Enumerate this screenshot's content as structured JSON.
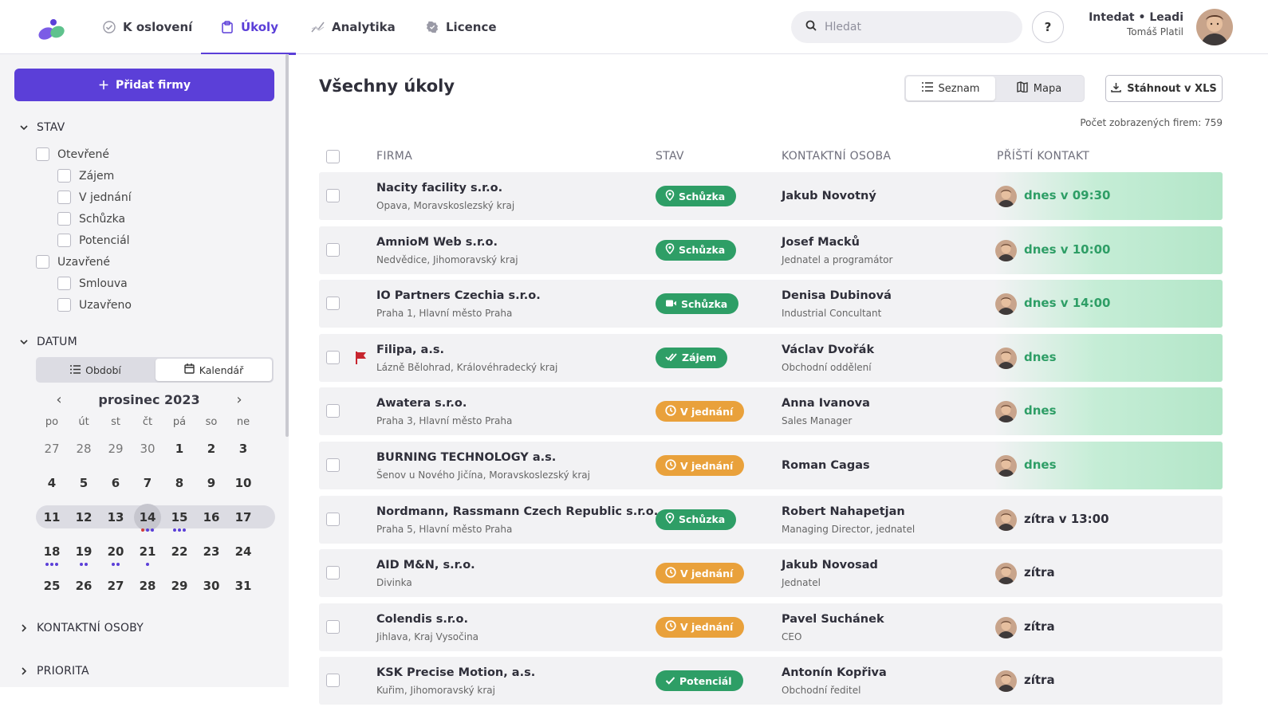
{
  "nav": {
    "items": [
      {
        "label": "K oslovení",
        "icon": "check-circle-icon"
      },
      {
        "label": "Úkoly",
        "icon": "clipboard-icon",
        "active": true
      },
      {
        "label": "Analytika",
        "icon": "chart-line-icon"
      },
      {
        "label": "Licence",
        "icon": "badge-icon"
      }
    ],
    "search_placeholder": "Hledat",
    "help_label": "?",
    "user_company": "Intedat • Leadi",
    "user_name": "Tomáš Platil"
  },
  "sidebar": {
    "add_button": "Přidat firmy",
    "stav": {
      "title": "STAV",
      "items": [
        {
          "label": "Otevřené",
          "level": 0
        },
        {
          "label": "Zájem",
          "level": 1
        },
        {
          "label": "V jednání",
          "level": 1
        },
        {
          "label": "Schůzka",
          "level": 1
        },
        {
          "label": "Potenciál",
          "level": 1
        },
        {
          "label": "Uzavřené",
          "level": 0
        },
        {
          "label": "Smlouva",
          "level": 1
        },
        {
          "label": "Uzavřeno",
          "level": 1
        }
      ]
    },
    "datum": {
      "title": "DATUM",
      "seg_period": "Období",
      "seg_calendar": "Kalendář",
      "month": "prosinec 2023",
      "dow": [
        "po",
        "út",
        "st",
        "čt",
        "pá",
        "so",
        "ne"
      ],
      "weeks": [
        [
          "27",
          "28",
          "29",
          "30",
          "1",
          "2",
          "3"
        ],
        [
          "4",
          "5",
          "6",
          "7",
          "8",
          "9",
          "10"
        ],
        [
          "11",
          "12",
          "13",
          "14",
          "15",
          "16",
          "17"
        ],
        [
          "18",
          "19",
          "20",
          "21",
          "22",
          "23",
          "24"
        ],
        [
          "25",
          "26",
          "27",
          "28",
          "29",
          "30",
          "31"
        ]
      ],
      "today": "14",
      "dots": {
        "14": [
          "#d33b3b",
          "#5b3fd8",
          "#5b3fd8"
        ],
        "15": [
          "#5b3fd8",
          "#5b3fd8",
          "#5b3fd8"
        ],
        "18": [
          "#5b3fd8",
          "#5b3fd8",
          "#5b3fd8"
        ],
        "19": [
          "#5b3fd8",
          "#5b3fd8"
        ],
        "20": [
          "#5b3fd8",
          "#5b3fd8"
        ],
        "21": [
          "#5b3fd8"
        ]
      }
    },
    "kontaktni_osoby": "KONTAKTNÍ OSOBY",
    "priorita": "PRIORITA"
  },
  "main": {
    "title": "Všechny úkoly",
    "view_list": "Seznam",
    "view_map": "Mapa",
    "download": "Stáhnout v XLS",
    "count": "Počet zobrazených firem: 759",
    "headers": {
      "firma": "FIRMA",
      "stav": "STAV",
      "kontakt": "KONTAKTNÍ OSOBA",
      "next": "PŘÍŠTÍ KONTAKT"
    },
    "colors": {
      "green": "#2e9e66",
      "orange": "#e9a13b",
      "accent": "#5b3fd8"
    },
    "rows": [
      {
        "firm": "Nacity facility s.r.o.",
        "loc": "Opava, Moravskoslezský kraj",
        "status": "Schůzka",
        "status_icon": "pin-icon",
        "status_color": "green",
        "contact": "Jakub Novotný",
        "role": "",
        "next": "dnes v 09:30",
        "highlight": true,
        "flag": false
      },
      {
        "firm": "AmnioM Web s.r.o.",
        "loc": "Nedvědice, Jihomoravský kraj",
        "status": "Schůzka",
        "status_icon": "pin-icon",
        "status_color": "green",
        "contact": "Josef Macků",
        "role": "Jednatel a programátor",
        "next": "dnes v 10:00",
        "highlight": true,
        "flag": false
      },
      {
        "firm": "IO Partners Czechia s.r.o.",
        "loc": "Praha 1, Hlavní město Praha",
        "status": "Schůzka",
        "status_icon": "video-icon",
        "status_color": "green",
        "contact": "Denisa Dubinová",
        "role": "Industrial Concultant",
        "next": "dnes v 14:00",
        "highlight": true,
        "flag": false
      },
      {
        "firm": "Filipa, a.s.",
        "loc": "Lázně Bělohrad, Královéhradecký kraj",
        "status": "Zájem",
        "status_icon": "check-double-icon",
        "status_color": "green",
        "contact": "Václav Dvořák",
        "role": "Obchodní oddělení",
        "next": "dnes",
        "highlight": true,
        "flag": true
      },
      {
        "firm": "Awatera s.r.o.",
        "loc": "Praha 3, Hlavní město Praha",
        "status": "V jednání",
        "status_icon": "clock-icon",
        "status_color": "orange",
        "contact": "Anna Ivanova",
        "role": "Sales Manager",
        "next": "dnes",
        "highlight": true,
        "flag": false
      },
      {
        "firm": "BURNING TECHNOLOGY a.s.",
        "loc": "Šenov u Nového Jičína, Moravskoslezský kraj",
        "status": "V jednání",
        "status_icon": "clock-icon",
        "status_color": "orange",
        "contact": "Roman Cagas",
        "role": "",
        "next": "dnes",
        "highlight": true,
        "flag": false
      },
      {
        "firm": "Nordmann, Rassmann Czech Republic s.r.o.",
        "loc": "Praha 5, Hlavní město Praha",
        "status": "Schůzka",
        "status_icon": "pin-icon",
        "status_color": "green",
        "contact": "Robert Nahapetjan",
        "role": "Managing Director, jednatel",
        "next": "zítra v 13:00",
        "highlight": false,
        "flag": false
      },
      {
        "firm": "AID M&N, s.r.o.",
        "loc": "Divinka",
        "status": "V jednání",
        "status_icon": "clock-icon",
        "status_color": "orange",
        "contact": "Jakub Novosad",
        "role": "Jednatel",
        "next": "zítra",
        "highlight": false,
        "flag": false
      },
      {
        "firm": "Colendis s.r.o.",
        "loc": "Jihlava, Kraj Vysočina",
        "status": "V jednání",
        "status_icon": "clock-icon",
        "status_color": "orange",
        "contact": "Pavel Suchánek",
        "role": "CEO",
        "next": "zítra",
        "highlight": false,
        "flag": false
      },
      {
        "firm": "KSK Precise Motion, a.s.",
        "loc": "Kuřim, Jihomoravský kraj",
        "status": "Potenciál",
        "status_icon": "check-icon",
        "status_color": "green",
        "contact": "Antonín Kopřiva",
        "role": "Obchodní ředitel",
        "next": "zítra",
        "highlight": false,
        "flag": false
      }
    ]
  }
}
